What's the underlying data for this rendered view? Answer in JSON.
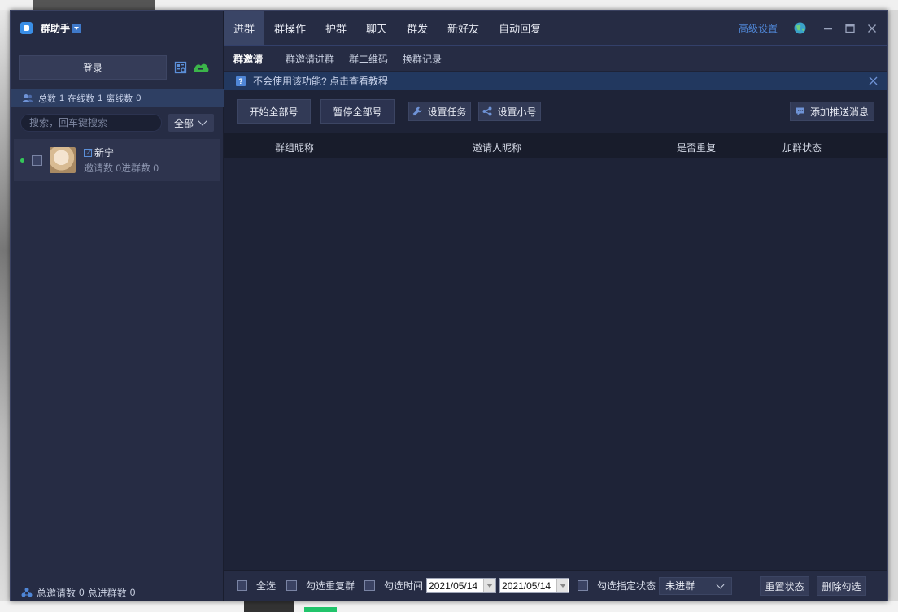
{
  "app": {
    "name": "群助手"
  },
  "sidebar": {
    "login_label": "登录",
    "stats": {
      "total_label": "总数",
      "total": "1",
      "online_label": "在线数",
      "online": "1",
      "offline_label": "离线数",
      "offline": "0"
    },
    "search_placeholder": "搜索，回车键搜索",
    "filter_value": "全部",
    "accounts": [
      {
        "name": "新宁",
        "sub": "邀请数 0进群数 0"
      }
    ],
    "footer": {
      "invites_label": "总邀请数",
      "invites": "0",
      "joins_label": "总进群数",
      "joins": "0"
    }
  },
  "topnav": {
    "tabs": [
      "进群",
      "群操作",
      "护群",
      "聊天",
      "群发",
      "新好友",
      "自动回复"
    ],
    "advanced_label": "高级设置"
  },
  "subtabs": [
    "群邀请",
    "群邀请进群",
    "群二维码",
    "换群记录"
  ],
  "notice": {
    "text": "不会使用该功能? 点击查看教程"
  },
  "toolbar": {
    "start_all": "开始全部号",
    "pause_all": "暂停全部号",
    "set_task": "设置任务",
    "set_sub": "设置小号",
    "add_push": "添加推送消息"
  },
  "table": {
    "columns": [
      "群组昵称",
      "邀请人昵称",
      "是否重复",
      "加群状态"
    ]
  },
  "bottom": {
    "select_all": "全选",
    "select_dup": "勾选重复群",
    "select_time": "勾选时间",
    "date_from": "2021/05/14",
    "date_to": "2021/05/14",
    "select_state": "勾选指定状态",
    "state_value": "未进群",
    "reset": "重置状态",
    "delete": "删除勾选"
  },
  "colors": {
    "accent": "#4f86d6",
    "online": "#34c759",
    "cloud": "#3bb54a"
  }
}
